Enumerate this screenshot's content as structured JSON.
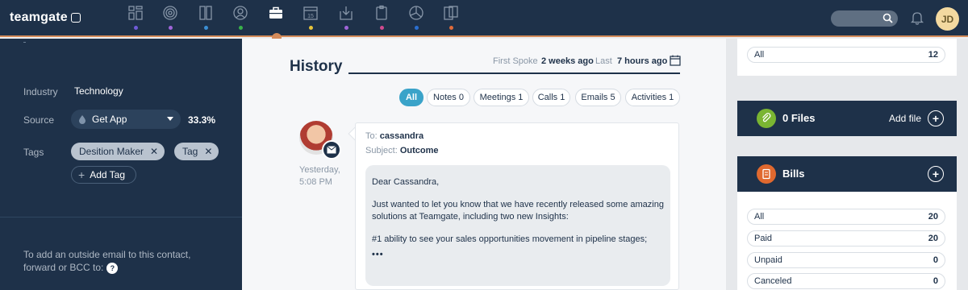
{
  "app": {
    "logo_text": "teamgate",
    "user_initials": "JD"
  },
  "nav": {
    "items": [
      {
        "icon": "dashboard-icon",
        "dot": "#6f5bd8"
      },
      {
        "icon": "target-icon",
        "dot": "#a065d9"
      },
      {
        "icon": "book-icon",
        "dot": "#3b8fd4"
      },
      {
        "icon": "person-icon",
        "dot": "#39b24a"
      },
      {
        "icon": "briefcase-icon",
        "dot": null
      },
      {
        "icon": "calendar-icon",
        "dot": "#e8c43a"
      },
      {
        "icon": "inbox-icon",
        "dot": "#a065d9"
      },
      {
        "icon": "clipboard-icon",
        "dot": "#d04a8e"
      },
      {
        "icon": "pie-chart-icon",
        "dot": "#2a6fd1"
      },
      {
        "icon": "documents-icon",
        "dot": "#e06b3a"
      }
    ],
    "calendar_day": "15"
  },
  "contact": {
    "industry_label": "Industry",
    "industry_value": "Technology",
    "source_label": "Source",
    "source_value": "Get App",
    "source_pct": "33.3%",
    "tags_label": "Tags",
    "tags": [
      "Desition Maker",
      "Tag"
    ],
    "add_tag": "Add Tag",
    "email_note": "To add an outside email to this contact, forward or BCC to:",
    "help_mark": "?"
  },
  "history": {
    "title": "History",
    "first_spoke_label": "First Spoke",
    "first_spoke_value": "2 weeks ago",
    "last_label": "Last",
    "last_value": "7 hours ago",
    "filters": [
      "All",
      "Notes 0",
      "Meetings 1",
      "Calls 1",
      "Emails 5",
      "Activities 1"
    ],
    "entry": {
      "to_label": "To:",
      "to_value": "cassandra",
      "subject_label": "Subject:",
      "subject_value": "Outcome",
      "when_line1": "Yesterday,",
      "when_line2": "5:08 PM",
      "greeting": "Dear Cassandra,",
      "para1": "Just wanted to let you know that we have recently released some amazing solutions at Teamgate, including two new Insights:",
      "para2": "#1 ability to see your sales opportunities movement in pipeline stages;",
      "more": "•••"
    }
  },
  "side": {
    "top_all_label": "All",
    "top_all_count": "12",
    "files_title": "0 Files",
    "files_action": "Add file",
    "bills_title": "Bills",
    "bills": [
      {
        "label": "All",
        "count": "20"
      },
      {
        "label": "Paid",
        "count": "20"
      },
      {
        "label": "Unpaid",
        "count": "0"
      },
      {
        "label": "Canceled",
        "count": "0"
      }
    ],
    "colors": {
      "files_icon": "#7ab532",
      "bills_icon": "#e0692f",
      "active_filter": "#3aa3c9"
    }
  }
}
